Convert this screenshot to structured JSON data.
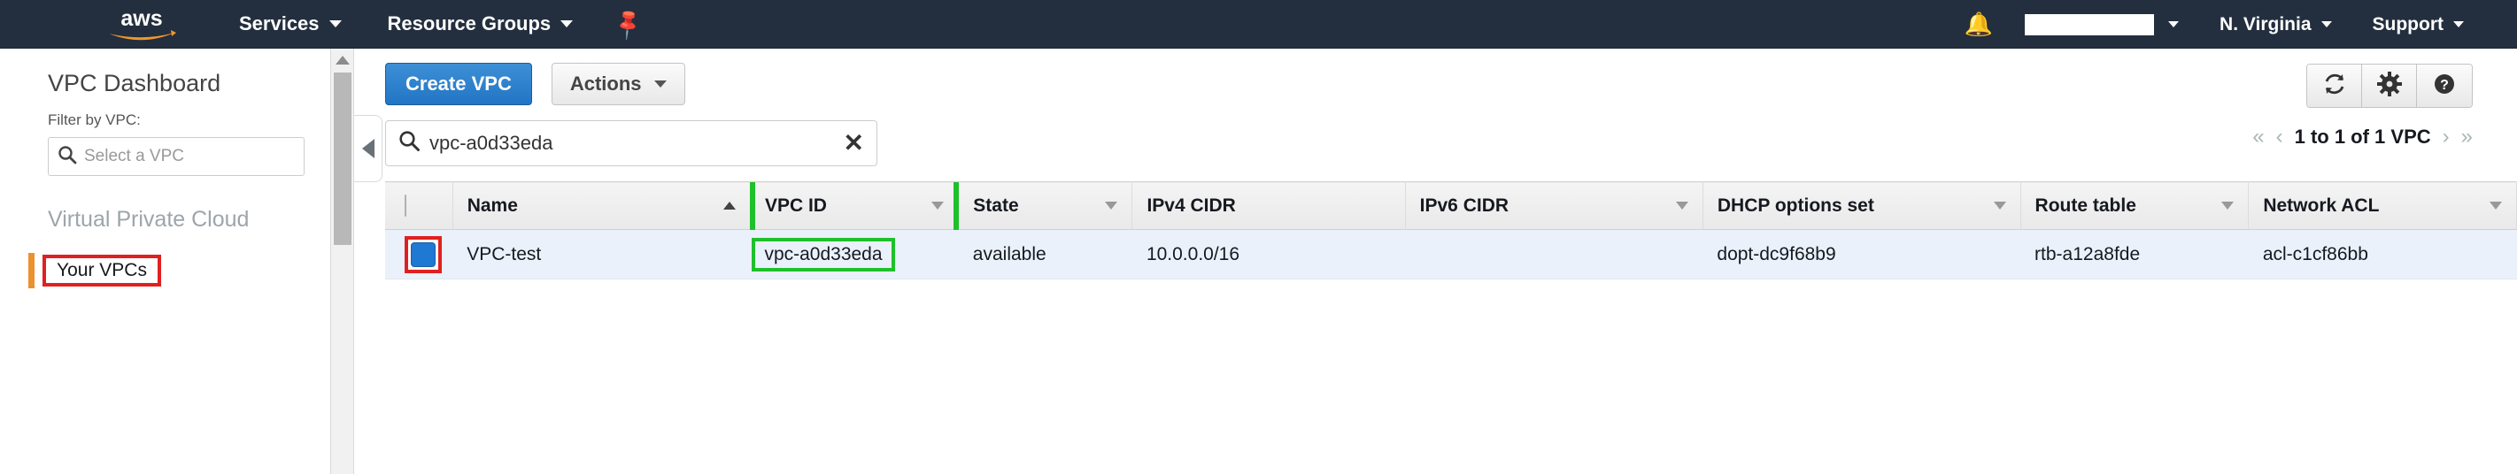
{
  "topnav": {
    "logo_alt": "aws",
    "services_label": "Services",
    "resource_groups_label": "Resource Groups",
    "pin_icon": "pin-icon",
    "bell_icon": "bell-icon",
    "account_value": "",
    "region_label": "N. Virginia",
    "support_label": "Support",
    "bg_color": "#232f3e"
  },
  "sidebar": {
    "title": "VPC Dashboard",
    "filter_label": "Filter by VPC:",
    "filter_placeholder": "Select a VPC",
    "section_title": "Virtual Private Cloud",
    "active_item": "Your VPCs",
    "active_bar_color": "#ec912d",
    "annotation_color": "#e02020"
  },
  "toolbar": {
    "create_label": "Create VPC",
    "actions_label": "Actions",
    "refresh_icon": "refresh-icon",
    "settings_icon": "gear-icon",
    "help_icon": "help-icon",
    "primary_color": "#2275c4"
  },
  "search": {
    "value": "vpc-a0d33eda",
    "search_icon": "search-icon",
    "clear_icon": "close-icon"
  },
  "pagination": {
    "first_icon": "«",
    "prev_icon": "‹",
    "summary": "1 to 1 of 1 VPC",
    "next_icon": "›",
    "last_icon": "»"
  },
  "table": {
    "columns": [
      {
        "label": "Name",
        "sort": "asc"
      },
      {
        "label": "VPC ID",
        "sort": "desc",
        "highlight": true
      },
      {
        "label": "State",
        "sort": "desc"
      },
      {
        "label": "IPv4 CIDR",
        "sort": "none"
      },
      {
        "label": "IPv6 CIDR",
        "sort": "desc"
      },
      {
        "label": "DHCP options set",
        "sort": "desc"
      },
      {
        "label": "Route table",
        "sort": "desc"
      },
      {
        "label": "Network ACL",
        "sort": "desc"
      }
    ],
    "rows": [
      {
        "selected": true,
        "name": "VPC-test",
        "vpc_id": "vpc-a0d33eda",
        "state": "available",
        "ipv4_cidr": "10.0.0.0/16",
        "ipv6_cidr": "",
        "dhcp_options_set": "dopt-dc9f68b9",
        "route_table": "rtb-a12a8fde",
        "network_acl": "acl-c1cf86bb"
      }
    ],
    "highlight_color": "#1ec02b",
    "state_color": "#1f8a2f",
    "row_bg": "#eaf1fb"
  }
}
